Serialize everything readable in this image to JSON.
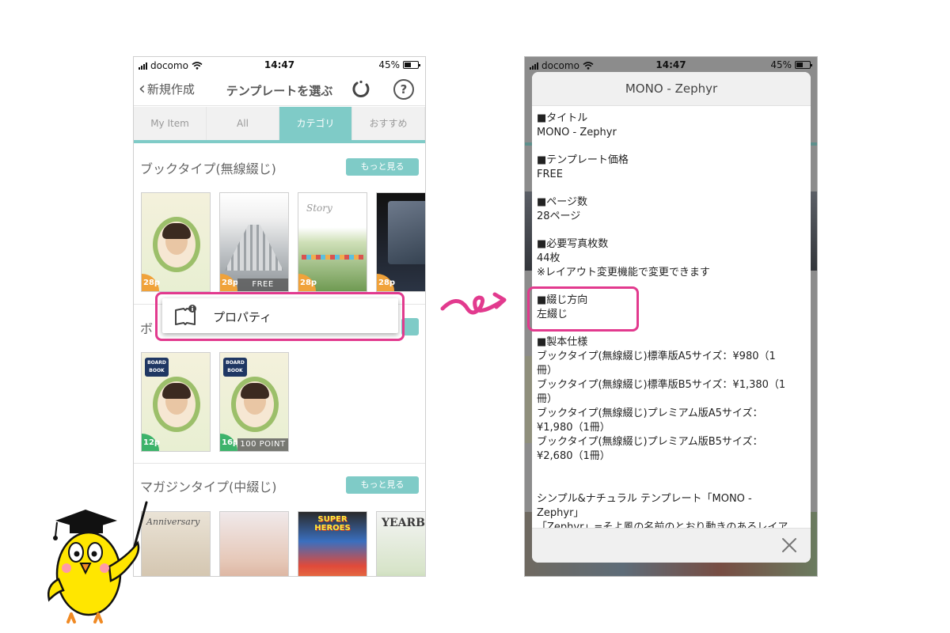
{
  "left": {
    "status": {
      "carrier": "docomo",
      "time": "14:47",
      "battery": "45%"
    },
    "nav": {
      "back": "新規作成",
      "title": "テンプレートを選ぶ",
      "help": "?"
    },
    "tabs": [
      {
        "label": "My Item",
        "active": false
      },
      {
        "label": "All",
        "active": false
      },
      {
        "label": "カテゴリ",
        "active": true
      },
      {
        "label": "おすすめ",
        "active": false
      }
    ],
    "sections": {
      "book": {
        "title": "ブックタイプ(無線綴じ)",
        "more": "もっと見る",
        "items": [
          {
            "pages": "28p",
            "price": ""
          },
          {
            "pages": "28p",
            "price": "FREE"
          },
          {
            "pages": "28p",
            "price": ""
          },
          {
            "pages": "28p",
            "price": ""
          }
        ],
        "story_script": "Story"
      },
      "board": {
        "title": "ボ",
        "board_label": "BOARD BOOK",
        "items": [
          {
            "pages": "12p",
            "price": ""
          },
          {
            "pages": "16p",
            "price": "100 POINT"
          }
        ]
      },
      "magazine": {
        "title": "マガジンタイプ(中綴じ)",
        "more": "もっと見る",
        "thumb_texts": [
          "Anniversary",
          "",
          "SUPER HEROES",
          "YEARBO"
        ]
      }
    },
    "context_menu": {
      "label": "プロパティ"
    }
  },
  "right": {
    "status": {
      "carrier": "docomo",
      "time": "14:47",
      "battery": "45%"
    },
    "modal": {
      "title": "MONO - Zephyr",
      "blocks": [
        {
          "heading": "タイトル",
          "lines": [
            "MONO - Zephyr"
          ]
        },
        {
          "heading": "テンプレート価格",
          "lines": [
            "FREE"
          ]
        },
        {
          "heading": "ページ数",
          "lines": [
            "28ページ"
          ]
        },
        {
          "heading": "必要写真枚数",
          "lines": [
            "44枚",
            "※レイアウト変更機能で変更できます"
          ]
        },
        {
          "heading": "綴じ方向",
          "lines": [
            "左綴じ"
          ]
        },
        {
          "heading": "製本仕様",
          "lines": [
            "ブックタイプ(無線綴じ)標準版A5サイズ：¥980（1",
            "冊）",
            "ブックタイプ(無線綴じ)標準版B5サイズ：¥1,380（1",
            "冊）",
            "ブックタイプ(無線綴じ)プレミアム版A5サイズ：",
            "¥1,980（1冊）",
            "ブックタイプ(無線綴じ)プレミアム版B5サイズ：",
            "¥2,680（1冊）"
          ]
        }
      ],
      "description": [
        "シンプル&ナチュラル テンプレート「MONO -",
        "Zephyr」",
        "「Zephyr」=そよ風の名前のとおり動きのあるレイア"
      ]
    }
  },
  "colors": {
    "accent": "#7fcbc7",
    "highlight": "#e23a8e",
    "page_badge": "#f0a23a",
    "page_badge_green": "#3db36b"
  }
}
